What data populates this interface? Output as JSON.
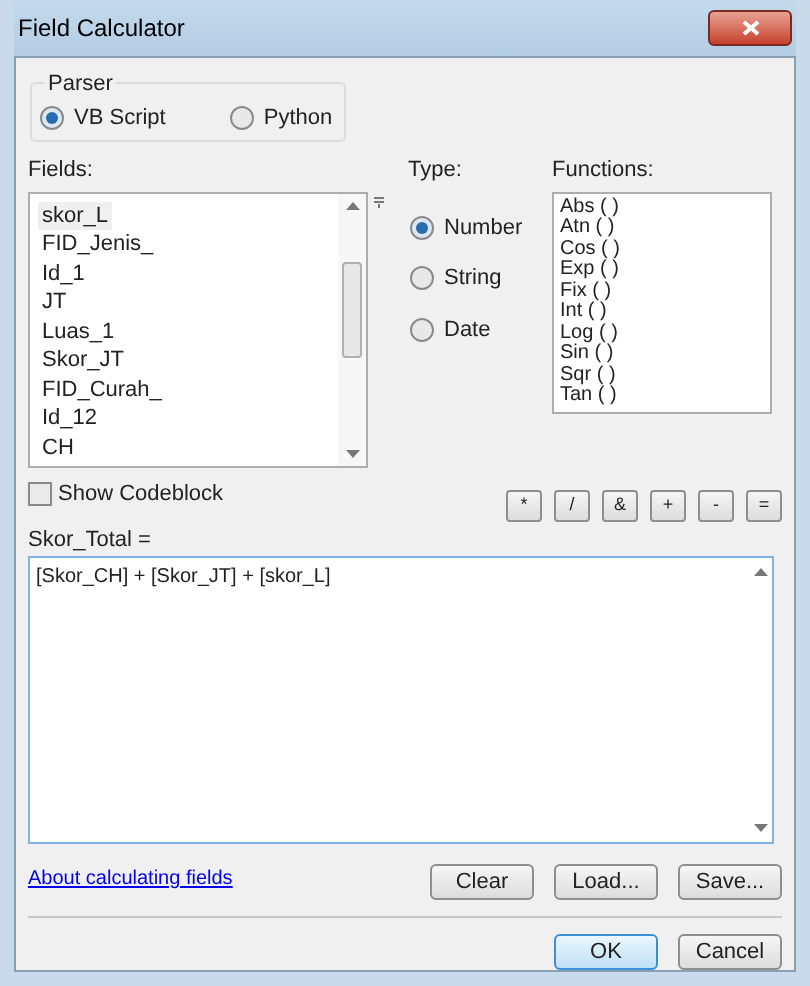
{
  "window": {
    "title": "Field Calculator"
  },
  "parser": {
    "label": "Parser",
    "options": [
      {
        "label": "VB Script",
        "selected": true
      },
      {
        "label": "Python",
        "selected": false
      }
    ]
  },
  "fields": {
    "label": "Fields:",
    "items": [
      {
        "label": "skor_L",
        "selected": true
      },
      {
        "label": "FID_Jenis_",
        "selected": false
      },
      {
        "label": "Id_1",
        "selected": false
      },
      {
        "label": "JT",
        "selected": false
      },
      {
        "label": "Luas_1",
        "selected": false
      },
      {
        "label": "Skor_JT",
        "selected": false
      },
      {
        "label": "FID_Curah_",
        "selected": false
      },
      {
        "label": "Id_12",
        "selected": false
      },
      {
        "label": "CH",
        "selected": false
      }
    ]
  },
  "type": {
    "label": "Type:",
    "options": [
      {
        "label": "Number",
        "selected": true
      },
      {
        "label": "String",
        "selected": false
      },
      {
        "label": "Date",
        "selected": false
      }
    ]
  },
  "functions": {
    "label": "Functions:",
    "items": [
      "Abs ( )",
      "Atn ( )",
      "Cos ( )",
      "Exp ( )",
      "Fix ( )",
      "Int ( )",
      "Log ( )",
      "Sin ( )",
      "Sqr ( )",
      "Tan ( )"
    ]
  },
  "show_codeblock": {
    "label": "Show Codeblock",
    "checked": false
  },
  "operators": [
    "*",
    "/",
    "&",
    "+",
    "-",
    "="
  ],
  "expression": {
    "label": "Skor_Total =",
    "value": "[Skor_CH] + [Skor_JT] + [skor_L]"
  },
  "help_link": "About calculating fields",
  "file_buttons": [
    "Clear",
    "Load...",
    "Save..."
  ],
  "dialog_buttons": [
    {
      "label": "OK",
      "default": true
    },
    {
      "label": "Cancel",
      "default": false
    }
  ]
}
